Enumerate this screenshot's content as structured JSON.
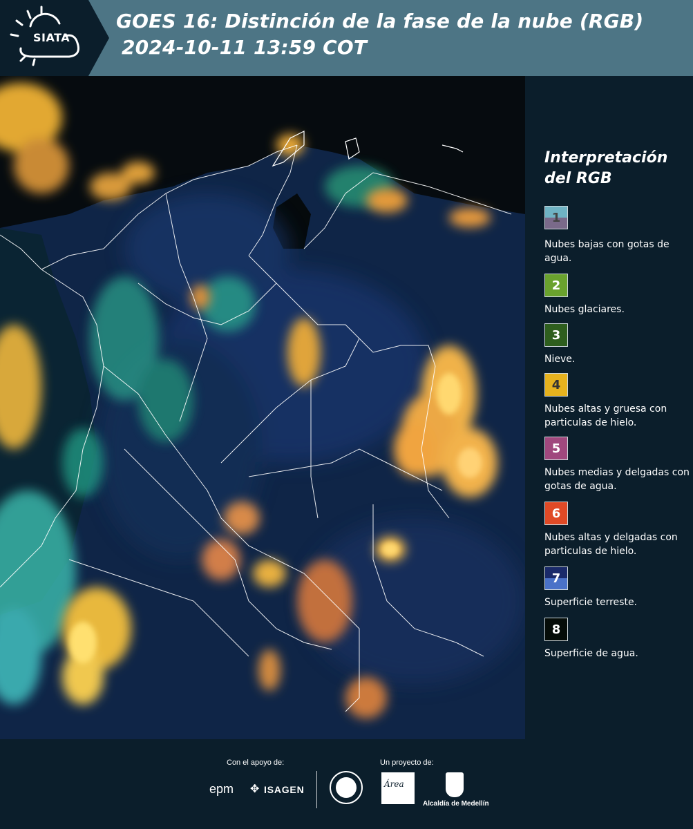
{
  "header": {
    "logo_text": "SIATA",
    "title_line1": "GOES 16: Distinción de la fase de la nube (RGB)",
    "title_line2": "2024-10-11 13:59 COT",
    "bg_color": "#4d7585"
  },
  "map": {
    "type": "satellite-rgb-cloud-phase",
    "borders": "white"
  },
  "legend": {
    "title": "Interpretación del RGB",
    "items": [
      {
        "number": "1",
        "label": "Nubes bajas con gotas de agua.",
        "colors": [
          "#6fb3c4",
          "#7a6a8a"
        ],
        "number_color": "#444444"
      },
      {
        "number": "2",
        "label": "Nubes glaciares.",
        "colors": [
          "#6aa22e"
        ],
        "number_color": "#ffffff"
      },
      {
        "number": "3",
        "label": "Nieve.",
        "colors": [
          "#2e5e1e"
        ],
        "number_color": "#ffffff"
      },
      {
        "number": "4",
        "label": "Nubes altas y gruesa con particulas de hielo.",
        "colors": [
          "#e6b21e"
        ],
        "number_color": "#333333"
      },
      {
        "number": "5",
        "label": "Nubes medias y delgadas con gotas de agua.",
        "colors": [
          "#a0487e"
        ],
        "number_color": "#ffffff"
      },
      {
        "number": "6",
        "label": "Nubes altas y delgadas con particulas de hielo.",
        "colors": [
          "#e04a26"
        ],
        "number_color": "#ffffff"
      },
      {
        "number": "7",
        "label": "Superficie terreste.",
        "colors": [
          "#1a2a6a",
          "#4a72c8"
        ],
        "number_color": "#ffffff"
      },
      {
        "number": "8",
        "label": "Superficie de agua.",
        "colors": [
          "#050c08"
        ],
        "number_color": "#ffffff"
      }
    ]
  },
  "footer": {
    "support_label": "Con el apoyo de:",
    "project_label": "Un proyecto de:",
    "epm": "epm",
    "isagen": "ISAGEN",
    "area_logo": "Área",
    "alcaldia": "Alcaldía de Medellín"
  }
}
